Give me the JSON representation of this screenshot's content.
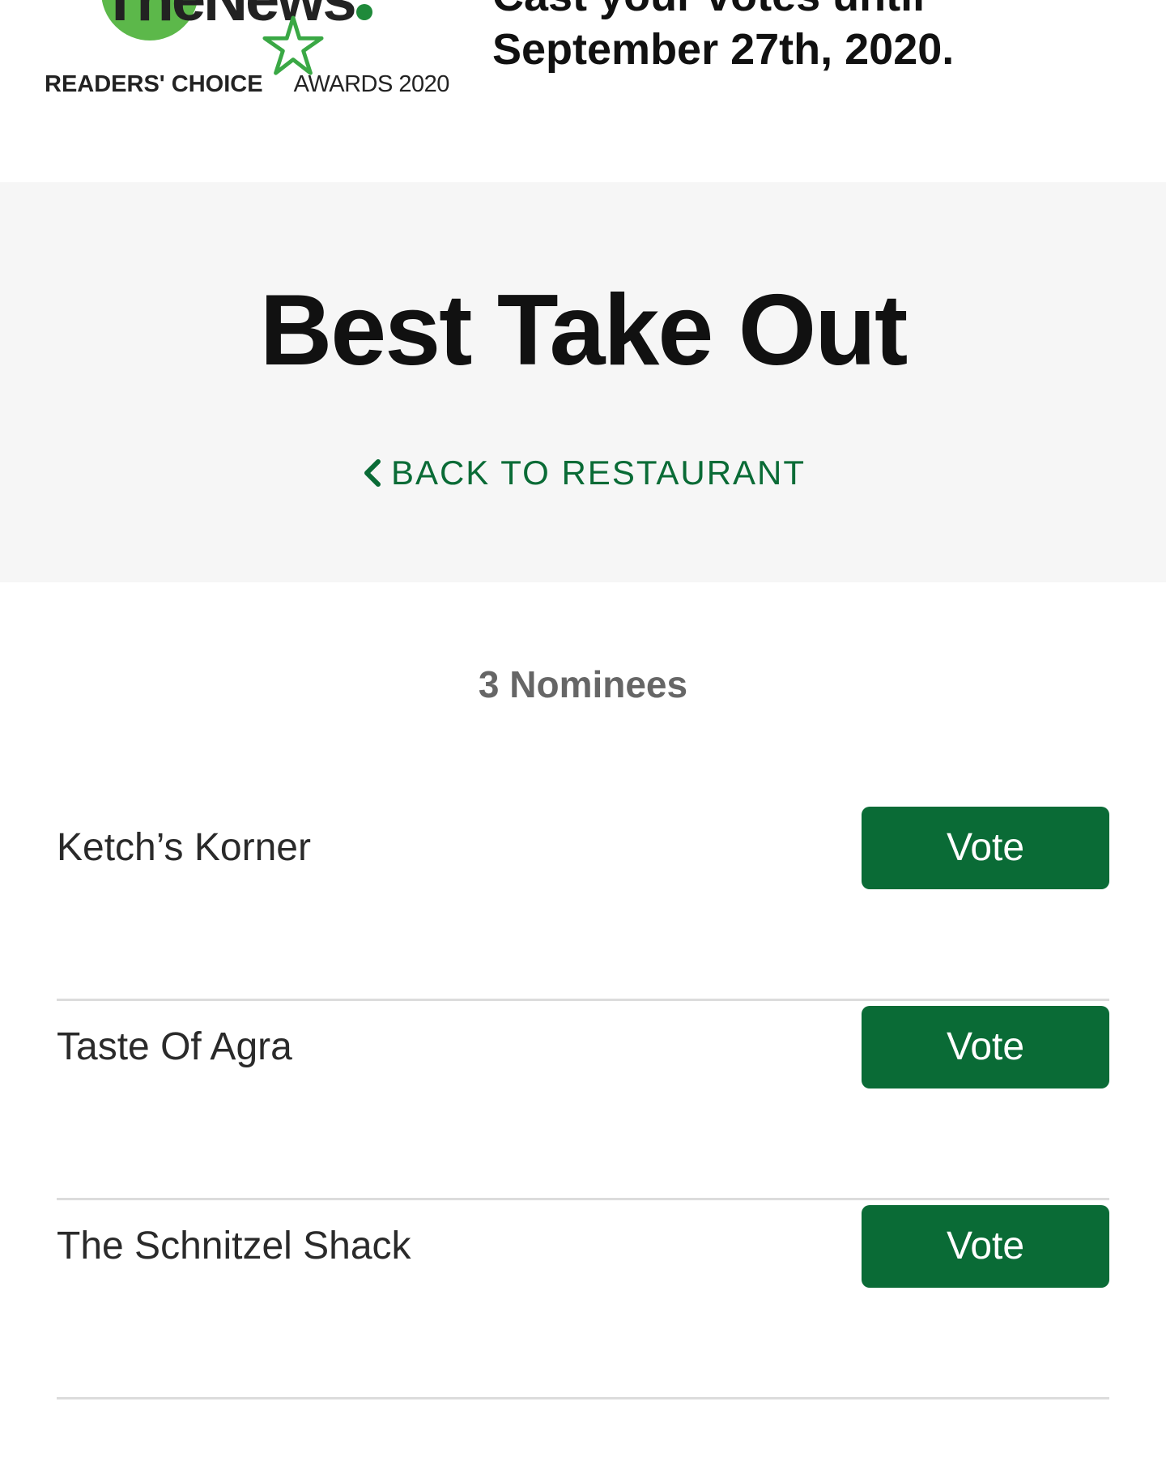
{
  "header": {
    "logo": {
      "wordmark": "TheNews",
      "tagline_bold": "READERS' CHOICE",
      "tagline_light": "AWARDS 2020"
    },
    "deadline_line1": "Cast your votes until",
    "deadline_line2": "September 27th, 2020."
  },
  "hero": {
    "title": "Best Take Out",
    "back_link": "BACK TO RESTAURANT",
    "back_icon": "chevron-left-icon"
  },
  "nominees": {
    "count_label": "3 Nominees",
    "items": [
      {
        "name": "Ketch’s Korner",
        "button": "Vote"
      },
      {
        "name": "Taste Of Agra",
        "button": "Vote"
      },
      {
        "name": "The Schnitzel Shack",
        "button": "Vote"
      }
    ]
  },
  "colors": {
    "accent": "#0a6b36",
    "logo_green": "#5cb84a",
    "hero_bg": "#f6f6f6",
    "divider": "#dcdcdc"
  }
}
